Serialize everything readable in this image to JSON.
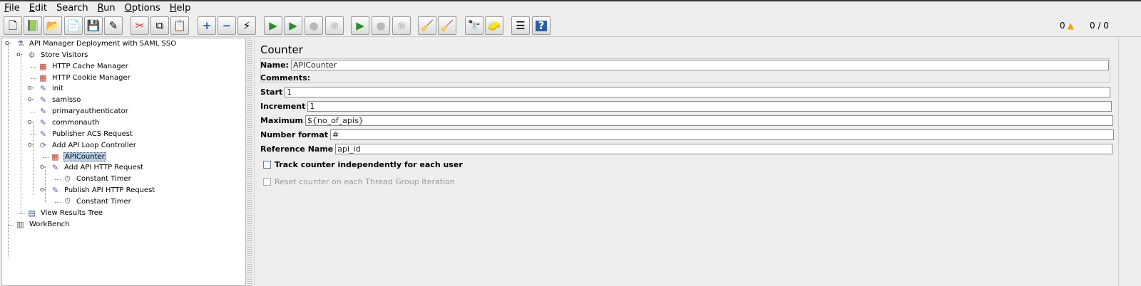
{
  "menu": [
    {
      "label": "File",
      "u": "F",
      "rest": "ile"
    },
    {
      "label": "Edit",
      "u": "E",
      "rest": "dit"
    },
    {
      "label": "Search",
      "u": "",
      "rest": "Search"
    },
    {
      "label": "Run",
      "u": "R",
      "rest": "un"
    },
    {
      "label": "Options",
      "u": "O",
      "rest": "ptions"
    },
    {
      "label": "Help",
      "u": "H",
      "rest": "elp"
    }
  ],
  "toolbar": {
    "buttons": [
      {
        "name": "new-icon",
        "glyph": "🗋"
      },
      {
        "name": "templates-icon",
        "glyph": "📗"
      },
      {
        "name": "open-icon",
        "glyph": "📂"
      },
      {
        "name": "close-file-icon",
        "glyph": "📄"
      },
      {
        "name": "save-icon",
        "glyph": "💾"
      },
      {
        "name": "save-as-icon",
        "glyph": "✎"
      },
      {
        "name": "cut-icon",
        "glyph": "✂"
      },
      {
        "name": "copy-icon",
        "glyph": "⧉"
      },
      {
        "name": "paste-icon",
        "glyph": "📋"
      },
      {
        "name": "expand-icon",
        "glyph": "+"
      },
      {
        "name": "collapse-icon",
        "glyph": "−"
      },
      {
        "name": "toggle-icon",
        "glyph": "⚡"
      },
      {
        "name": "start-icon",
        "glyph": "▶"
      },
      {
        "name": "start-no-pauses-icon",
        "glyph": "▶"
      },
      {
        "name": "stop-icon",
        "glyph": "●"
      },
      {
        "name": "shutdown-icon",
        "glyph": "⊗"
      },
      {
        "name": "remote-start-icon",
        "glyph": "▶"
      },
      {
        "name": "remote-stop-icon",
        "glyph": "●"
      },
      {
        "name": "remote-shutdown-icon",
        "glyph": "⊗"
      },
      {
        "name": "clear-icon",
        "glyph": "🧹"
      },
      {
        "name": "clear-all-icon",
        "glyph": "🧹"
      },
      {
        "name": "search-icon",
        "glyph": "🔭"
      },
      {
        "name": "reset-search-icon",
        "glyph": "🧽"
      },
      {
        "name": "function-helper-icon",
        "glyph": "☰"
      },
      {
        "name": "help-icon",
        "glyph": "?"
      }
    ],
    "error_count": "0",
    "warn_icon": "warning-icon",
    "threads": "0 / 0"
  },
  "tree": [
    {
      "label": "API Manager Deployment with SAML SSO",
      "icon": "flask-icon",
      "glyph": "⚗",
      "cls": "ic-flask"
    },
    {
      "label": "Store Visitors",
      "icon": "thread-group-icon",
      "glyph": "⚙",
      "cls": "ic-group"
    },
    {
      "label": "HTTP Cache Manager",
      "icon": "config-element-icon",
      "glyph": "▦",
      "cls": "ic-tools"
    },
    {
      "label": "HTTP Cookie Manager",
      "icon": "config-element-icon",
      "glyph": "▦",
      "cls": "ic-tools"
    },
    {
      "label": "init",
      "icon": "sampler-icon",
      "glyph": "✎",
      "cls": "ic-dropper"
    },
    {
      "label": "samlsso",
      "icon": "sampler-icon",
      "glyph": "✎",
      "cls": "ic-dropper"
    },
    {
      "label": "primaryauthenticator",
      "icon": "sampler-icon",
      "glyph": "✎",
      "cls": "ic-dropper"
    },
    {
      "label": "commonauth",
      "icon": "sampler-icon",
      "glyph": "✎",
      "cls": "ic-dropper"
    },
    {
      "label": "Publisher ACS Request",
      "icon": "sampler-icon",
      "glyph": "✎",
      "cls": "ic-dropper"
    },
    {
      "label": "Add API Loop Controller",
      "icon": "loop-controller-icon",
      "glyph": "⟳",
      "cls": "ic-loop"
    },
    {
      "label": "APICounter",
      "icon": "counter-icon",
      "glyph": "▦",
      "cls": "ic-tools"
    },
    {
      "label": "Add API HTTP Request",
      "icon": "sampler-icon",
      "glyph": "✎",
      "cls": "ic-dropper"
    },
    {
      "label": "Constant Timer",
      "icon": "timer-icon",
      "glyph": "⏱",
      "cls": "ic-timer"
    },
    {
      "label": "Publish API HTTP Request",
      "icon": "sampler-icon",
      "glyph": "✎",
      "cls": "ic-dropper"
    },
    {
      "label": "Constant Timer",
      "icon": "timer-icon",
      "glyph": "⏱",
      "cls": "ic-timer"
    },
    {
      "label": "View Results Tree",
      "icon": "listener-icon",
      "glyph": "▤",
      "cls": "ic-report"
    },
    {
      "label": "WorkBench",
      "icon": "workbench-icon",
      "glyph": "▥",
      "cls": "ic-bench"
    }
  ],
  "panel": {
    "title": "Counter",
    "name_label": "Name:",
    "name_value": "APICounter",
    "comments_label": "Comments:",
    "start_label": "Start",
    "start_value": "1",
    "increment_label": "Increment",
    "increment_value": "1",
    "maximum_label": "Maximum",
    "maximum_value": "${no_of_apis}",
    "format_label": "Number format",
    "format_value": "#",
    "refname_label": "Reference Name",
    "refname_value": "api_id",
    "track_label": "Track counter independently for each user",
    "reset_label": "Reset counter on each Thread Group Iteration"
  }
}
